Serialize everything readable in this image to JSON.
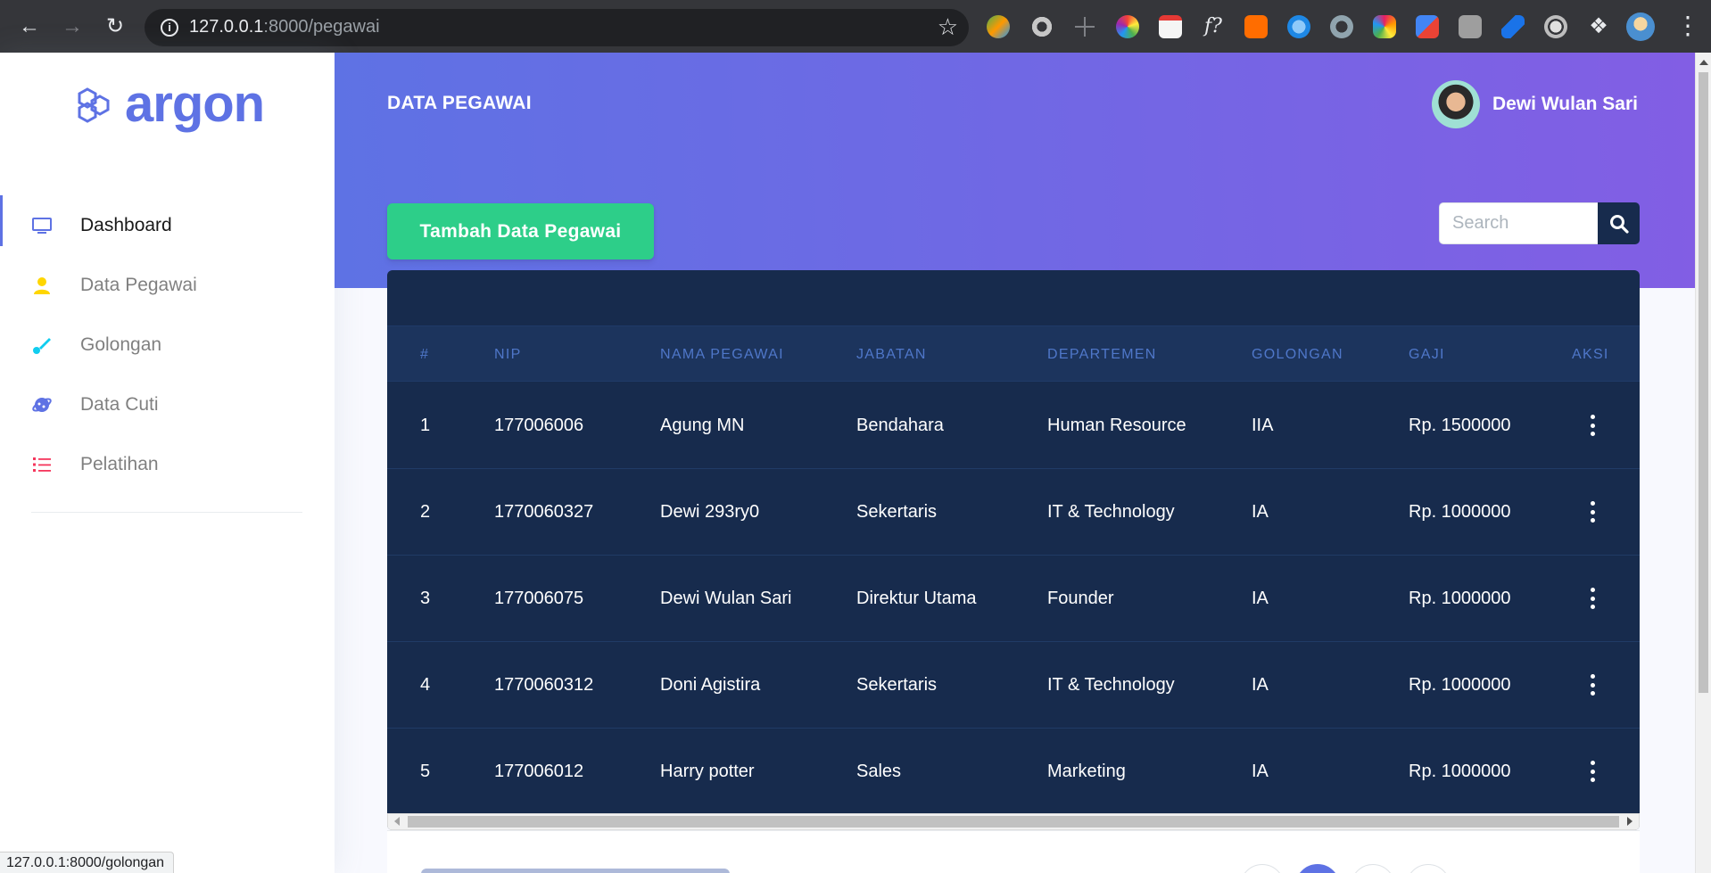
{
  "browser": {
    "url_host": "127.0.0.1",
    "url_path": ":8000/pegawai",
    "status_url": "127.0.0.1:8000/golongan"
  },
  "brand": {
    "name": "argon",
    "color": "#5e72e4"
  },
  "sidebar": {
    "items": [
      {
        "label": "Dashboard",
        "icon": "tv-icon",
        "color": "#5e72e4",
        "active": true
      },
      {
        "label": "Data Pegawai",
        "icon": "user-icon",
        "color": "#ffd600",
        "active": false
      },
      {
        "label": "Golongan",
        "icon": "brush-icon",
        "color": "#11cdef",
        "active": false
      },
      {
        "label": "Data Cuti",
        "icon": "planet-icon",
        "color": "#5e72e4",
        "active": false
      },
      {
        "label": "Pelatihan",
        "icon": "list-icon",
        "color": "#f5365c",
        "active": false
      }
    ]
  },
  "header": {
    "title": "DATA PEGAWAI",
    "user_name": "Dewi Wulan Sari"
  },
  "actions": {
    "add_label": "Tambah Data Pegawai",
    "search_placeholder": "Search"
  },
  "table": {
    "columns": [
      "#",
      "NIP",
      "NAMA PEGAWAI",
      "JABATAN",
      "DEPARTEMEN",
      "GOLONGAN",
      "GAJI",
      "AKSI"
    ],
    "rows": [
      {
        "no": "1",
        "nip": "177006006",
        "nama": "Agung MN",
        "jabatan": "Bendahara",
        "departemen": "Human Resource",
        "golongan": "IIA",
        "gaji": "Rp. 1500000"
      },
      {
        "no": "2",
        "nip": "1770060327",
        "nama": "Dewi 293ry0",
        "jabatan": "Sekertaris",
        "departemen": "IT & Technology",
        "golongan": "IA",
        "gaji": "Rp. 1000000"
      },
      {
        "no": "3",
        "nip": "177006075",
        "nama": "Dewi Wulan Sari",
        "jabatan": "Direktur Utama",
        "departemen": "Founder",
        "golongan": "IA",
        "gaji": "Rp. 1000000"
      },
      {
        "no": "4",
        "nip": "1770060312",
        "nama": "Doni Agistira",
        "jabatan": "Sekertaris",
        "departemen": "IT & Technology",
        "golongan": "IA",
        "gaji": "Rp. 1000000"
      },
      {
        "no": "5",
        "nip": "177006012",
        "nama": "Harry potter",
        "jabatan": "Sales",
        "departemen": "Marketing",
        "golongan": "IA",
        "gaji": "Rp. 1000000"
      }
    ]
  },
  "colors": {
    "primary": "#5e72e4",
    "success": "#2dce89",
    "table_bg": "#172b4d"
  }
}
